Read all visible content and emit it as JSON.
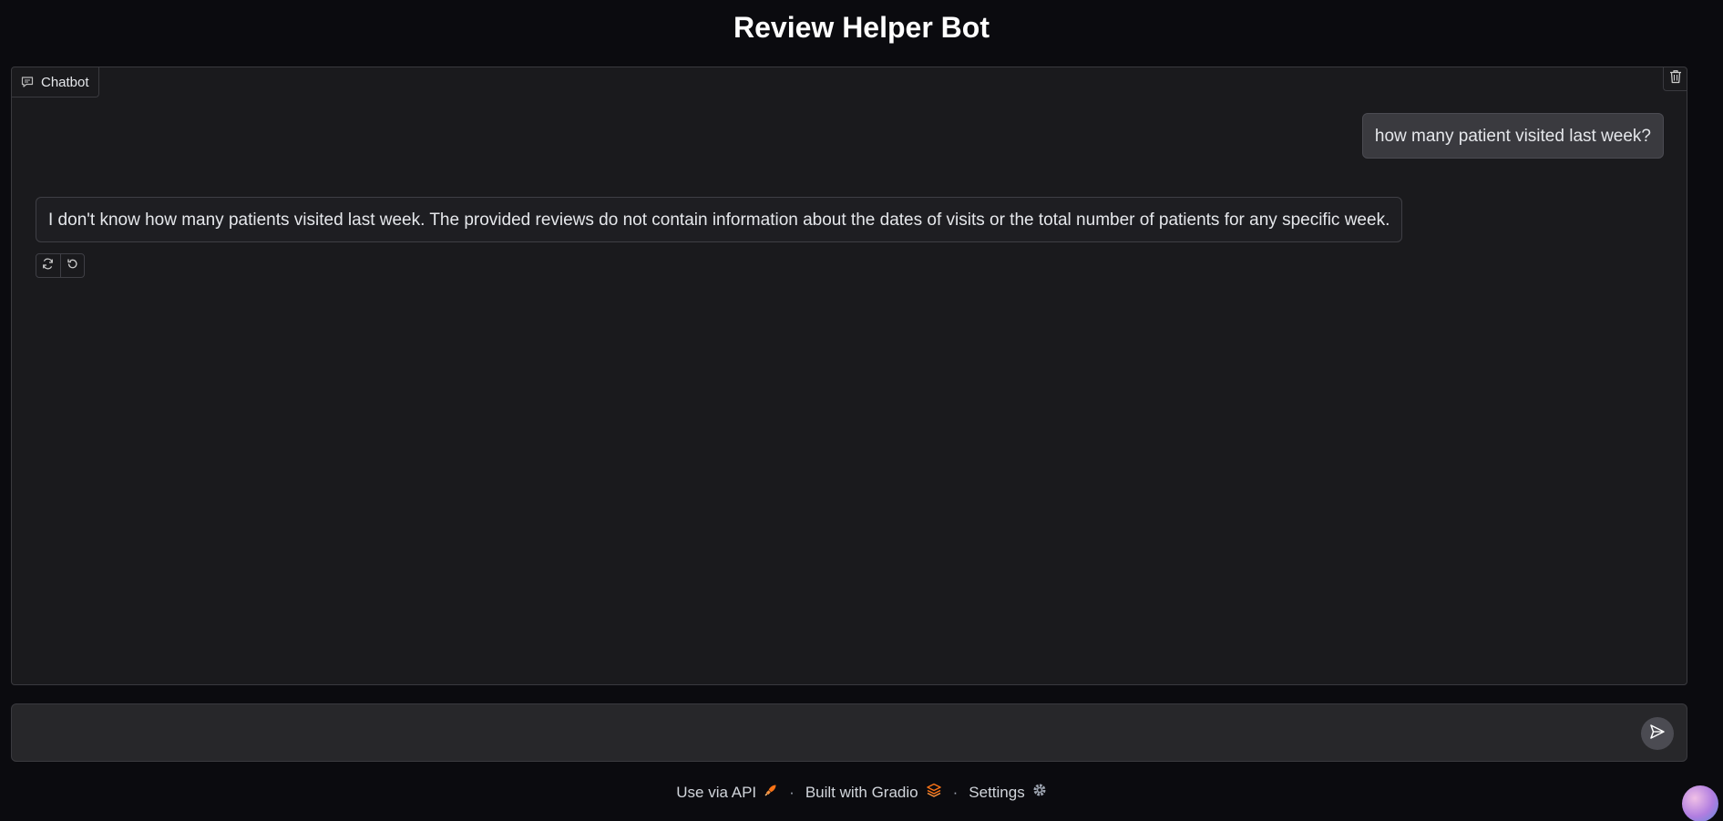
{
  "app": {
    "title": "Review Helper Bot"
  },
  "chatbot": {
    "label": "Chatbot",
    "messages": [
      {
        "role": "user",
        "text": "how many patient visited last week?"
      },
      {
        "role": "bot",
        "text": "I don't know how many patients visited last week. The provided reviews do not contain information about the dates of visits or the total number of patients for any specific week."
      }
    ]
  },
  "input": {
    "value": "",
    "placeholder": ""
  },
  "footer": {
    "api_label": "Use via API",
    "built_label": "Built with Gradio",
    "settings_label": "Settings",
    "separator": "·"
  },
  "icons": {
    "chatbot": "chat-bubble-icon",
    "clear": "trash-icon",
    "retry": "refresh-icon",
    "undo": "undo-icon",
    "send": "send-icon",
    "api": "rocket-icon",
    "gradio": "gradio-logo-icon",
    "settings": "gear-icon"
  },
  "colors": {
    "accent": "#f97316",
    "background": "#0b0b0f",
    "panel": "#1a1a1d"
  }
}
